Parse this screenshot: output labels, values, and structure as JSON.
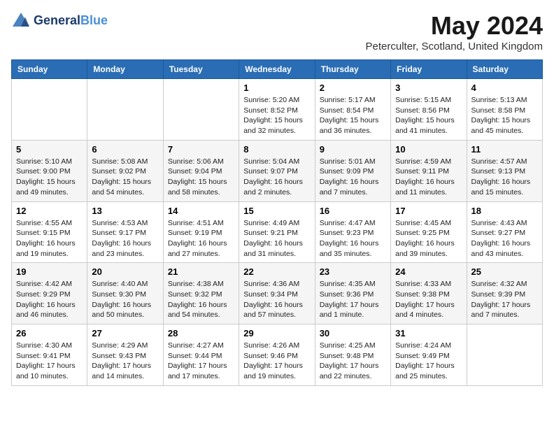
{
  "header": {
    "logo_line1": "General",
    "logo_line2": "Blue",
    "month_title": "May 2024",
    "location": "Peterculter, Scotland, United Kingdom"
  },
  "days_of_week": [
    "Sunday",
    "Monday",
    "Tuesday",
    "Wednesday",
    "Thursday",
    "Friday",
    "Saturday"
  ],
  "weeks": [
    [
      {
        "day": "",
        "info": ""
      },
      {
        "day": "",
        "info": ""
      },
      {
        "day": "",
        "info": ""
      },
      {
        "day": "1",
        "info": "Sunrise: 5:20 AM\nSunset: 8:52 PM\nDaylight: 15 hours\nand 32 minutes."
      },
      {
        "day": "2",
        "info": "Sunrise: 5:17 AM\nSunset: 8:54 PM\nDaylight: 15 hours\nand 36 minutes."
      },
      {
        "day": "3",
        "info": "Sunrise: 5:15 AM\nSunset: 8:56 PM\nDaylight: 15 hours\nand 41 minutes."
      },
      {
        "day": "4",
        "info": "Sunrise: 5:13 AM\nSunset: 8:58 PM\nDaylight: 15 hours\nand 45 minutes."
      }
    ],
    [
      {
        "day": "5",
        "info": "Sunrise: 5:10 AM\nSunset: 9:00 PM\nDaylight: 15 hours\nand 49 minutes."
      },
      {
        "day": "6",
        "info": "Sunrise: 5:08 AM\nSunset: 9:02 PM\nDaylight: 15 hours\nand 54 minutes."
      },
      {
        "day": "7",
        "info": "Sunrise: 5:06 AM\nSunset: 9:04 PM\nDaylight: 15 hours\nand 58 minutes."
      },
      {
        "day": "8",
        "info": "Sunrise: 5:04 AM\nSunset: 9:07 PM\nDaylight: 16 hours\nand 2 minutes."
      },
      {
        "day": "9",
        "info": "Sunrise: 5:01 AM\nSunset: 9:09 PM\nDaylight: 16 hours\nand 7 minutes."
      },
      {
        "day": "10",
        "info": "Sunrise: 4:59 AM\nSunset: 9:11 PM\nDaylight: 16 hours\nand 11 minutes."
      },
      {
        "day": "11",
        "info": "Sunrise: 4:57 AM\nSunset: 9:13 PM\nDaylight: 16 hours\nand 15 minutes."
      }
    ],
    [
      {
        "day": "12",
        "info": "Sunrise: 4:55 AM\nSunset: 9:15 PM\nDaylight: 16 hours\nand 19 minutes."
      },
      {
        "day": "13",
        "info": "Sunrise: 4:53 AM\nSunset: 9:17 PM\nDaylight: 16 hours\nand 23 minutes."
      },
      {
        "day": "14",
        "info": "Sunrise: 4:51 AM\nSunset: 9:19 PM\nDaylight: 16 hours\nand 27 minutes."
      },
      {
        "day": "15",
        "info": "Sunrise: 4:49 AM\nSunset: 9:21 PM\nDaylight: 16 hours\nand 31 minutes."
      },
      {
        "day": "16",
        "info": "Sunrise: 4:47 AM\nSunset: 9:23 PM\nDaylight: 16 hours\nand 35 minutes."
      },
      {
        "day": "17",
        "info": "Sunrise: 4:45 AM\nSunset: 9:25 PM\nDaylight: 16 hours\nand 39 minutes."
      },
      {
        "day": "18",
        "info": "Sunrise: 4:43 AM\nSunset: 9:27 PM\nDaylight: 16 hours\nand 43 minutes."
      }
    ],
    [
      {
        "day": "19",
        "info": "Sunrise: 4:42 AM\nSunset: 9:29 PM\nDaylight: 16 hours\nand 46 minutes."
      },
      {
        "day": "20",
        "info": "Sunrise: 4:40 AM\nSunset: 9:30 PM\nDaylight: 16 hours\nand 50 minutes."
      },
      {
        "day": "21",
        "info": "Sunrise: 4:38 AM\nSunset: 9:32 PM\nDaylight: 16 hours\nand 54 minutes."
      },
      {
        "day": "22",
        "info": "Sunrise: 4:36 AM\nSunset: 9:34 PM\nDaylight: 16 hours\nand 57 minutes."
      },
      {
        "day": "23",
        "info": "Sunrise: 4:35 AM\nSunset: 9:36 PM\nDaylight: 17 hours\nand 1 minute."
      },
      {
        "day": "24",
        "info": "Sunrise: 4:33 AM\nSunset: 9:38 PM\nDaylight: 17 hours\nand 4 minutes."
      },
      {
        "day": "25",
        "info": "Sunrise: 4:32 AM\nSunset: 9:39 PM\nDaylight: 17 hours\nand 7 minutes."
      }
    ],
    [
      {
        "day": "26",
        "info": "Sunrise: 4:30 AM\nSunset: 9:41 PM\nDaylight: 17 hours\nand 10 minutes."
      },
      {
        "day": "27",
        "info": "Sunrise: 4:29 AM\nSunset: 9:43 PM\nDaylight: 17 hours\nand 14 minutes."
      },
      {
        "day": "28",
        "info": "Sunrise: 4:27 AM\nSunset: 9:44 PM\nDaylight: 17 hours\nand 17 minutes."
      },
      {
        "day": "29",
        "info": "Sunrise: 4:26 AM\nSunset: 9:46 PM\nDaylight: 17 hours\nand 19 minutes."
      },
      {
        "day": "30",
        "info": "Sunrise: 4:25 AM\nSunset: 9:48 PM\nDaylight: 17 hours\nand 22 minutes."
      },
      {
        "day": "31",
        "info": "Sunrise: 4:24 AM\nSunset: 9:49 PM\nDaylight: 17 hours\nand 25 minutes."
      },
      {
        "day": "",
        "info": ""
      }
    ]
  ]
}
